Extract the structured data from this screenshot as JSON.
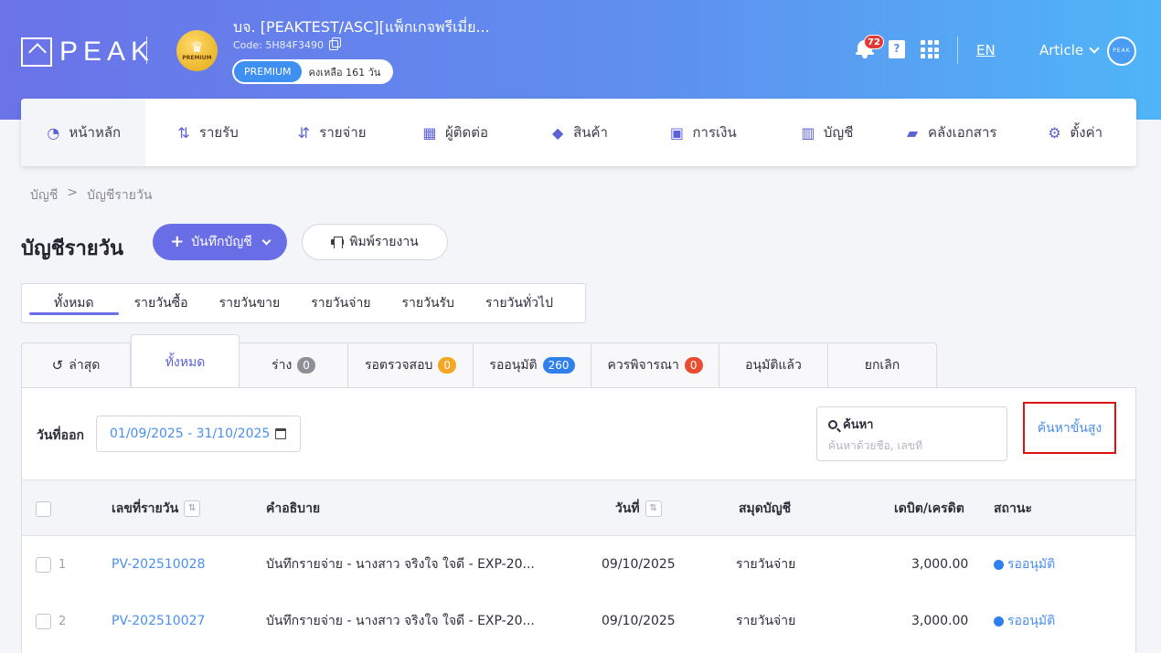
{
  "header": {
    "logo_text": "PEAK",
    "crown_label": "PREMIUM",
    "company_name": "บจ. [PEAKTEST/ASC][แพ็กเกจพรีเมี่ย...",
    "code": "Code: 5H84F3490",
    "plan_badge": "PREMIUM",
    "plan_days": "คงเหลือ 161 วัน",
    "notification_count": "72",
    "book_icon_glyph": "?",
    "language": "EN",
    "user_menu": "Article",
    "avatar_text": "PEAK"
  },
  "nav": {
    "items": [
      {
        "label": "หน้าหลัก",
        "icon": "dashboard-icon"
      },
      {
        "label": "รายรับ",
        "icon": "income-icon"
      },
      {
        "label": "รายจ่าย",
        "icon": "expense-icon"
      },
      {
        "label": "ผู้ติดต่อ",
        "icon": "contact-icon"
      },
      {
        "label": "สินค้า",
        "icon": "product-box-icon"
      },
      {
        "label": "การเงิน",
        "icon": "money-icon"
      },
      {
        "label": "บัญชี",
        "icon": "account-book-icon"
      },
      {
        "label": "คลังเอกสาร",
        "icon": "folder-icon"
      },
      {
        "label": "ตั้งค่า",
        "icon": "gear-icon"
      }
    ]
  },
  "breadcrumb": {
    "items": [
      "บัญชี",
      ">",
      "บัญชีรายวัน"
    ]
  },
  "page": {
    "title": "บัญชีรายวัน",
    "record_button": "บันทึกบัญชี",
    "print_button": "พิมพ์รายงาน"
  },
  "subtabs": [
    "ทั้งหมด",
    "รายวันซื้อ",
    "รายวันขาย",
    "รายวันจ่าย",
    "รายวันรับ",
    "รายวันทั่วไป"
  ],
  "status_tabs": [
    {
      "label": "ล่าสุด"
    },
    {
      "label": "ทั้งหมด"
    },
    {
      "label": "ร่าง",
      "count": "0"
    },
    {
      "label": "รอตรวจสอบ",
      "count": "0"
    },
    {
      "label": "รออนุมัติ",
      "count": "260"
    },
    {
      "label": "ควรพิจารณา",
      "count": "0"
    },
    {
      "label": "อนุมัติแล้ว"
    },
    {
      "label": "ยกเลิก"
    }
  ],
  "filter": {
    "date_label": "วันที่ออก",
    "date_range": "01/09/2025 - 31/10/2025",
    "search_title": "ค้นหา",
    "search_placeholder": "ค้นหาด้วยชื่อ, เลขที่",
    "advanced_search": "ค้นหาขั้นสูง"
  },
  "table": {
    "columns": [
      "เลขที่รายวัน",
      "คำอธิบาย",
      "วันที่",
      "สมุดบัญชี",
      "เดบิต/เครดิต",
      "สถานะ"
    ],
    "rows": [
      {
        "num": "1",
        "doc_no": "PV-202510028",
        "description": "บันทึกรายจ่าย - นางสาว จริงใจ ใจดี - EXP-20...",
        "date": "09/10/2025",
        "book": "รายวันจ่าย",
        "amount": "3,000.00",
        "status": "รออนุมัติ"
      },
      {
        "num": "2",
        "doc_no": "PV-202510027",
        "description": "บันทึกรายจ่าย - นางสาว จริงใจ ใจดี - EXP-20...",
        "date": "09/10/2025",
        "book": "รายวันจ่าย",
        "amount": "3,000.00",
        "status": "รออนุมัติ"
      }
    ]
  },
  "colors": {
    "accent": "#6a6ee6",
    "link": "#4a8ff0",
    "highlight_border": "#e01010"
  }
}
